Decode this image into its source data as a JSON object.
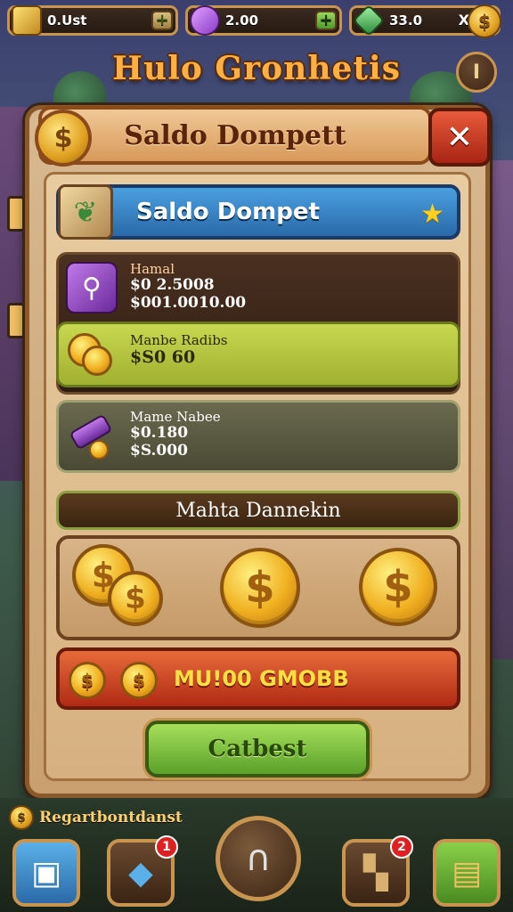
{
  "top_bar": {
    "resource_1": {
      "value": "0.Ust",
      "icon": "gold-bars-icon"
    },
    "resource_2": {
      "value": "2.00",
      "icon": "purple-gem-icon"
    },
    "resource_3": {
      "value": "33.0",
      "icon": "green-gem-icon",
      "close": "X"
    },
    "plus": "+",
    "coin_symbol": "$"
  },
  "game_title": "Hulo Gronhetis",
  "info_button": "I",
  "panel": {
    "title": "Saldo Dompett",
    "close": "✕",
    "coin_symbol": "$"
  },
  "wallet": {
    "title": "Saldo Dompet",
    "star": "★"
  },
  "items": [
    {
      "name": "Hamal",
      "line1": "$0 2.5008",
      "line2": "$001.0010.00",
      "icon": "purple-tool-icon"
    },
    {
      "name": "Manbe Radibs",
      "line1": "$S0 60",
      "icon": "gold-coin-stack-icon"
    },
    {
      "name": "Mame Nabee",
      "line1": "$0.180",
      "line2": "$S.000",
      "icon": "purple-scroll-icon"
    }
  ],
  "section": {
    "title": "Mahta Dannekin"
  },
  "big_coins": [
    "$",
    "$",
    "$",
    "$"
  ],
  "red_bar": {
    "label": "MU!00 GMOBB",
    "coin": "$"
  },
  "confirm_button": "Catbest",
  "bottom": {
    "label": "Regartbontdanst",
    "coin": "$",
    "badges": [
      "1",
      "2"
    ]
  },
  "colors": {
    "accent_gold": "#c89550",
    "wallet_blue": "#2a6aa8",
    "close_red": "#a82414",
    "confirm_green": "#5aa02a"
  }
}
